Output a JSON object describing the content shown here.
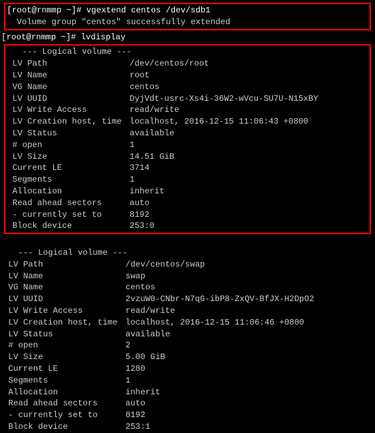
{
  "prompt1": {
    "full": "[root@rnmmp ~]# ",
    "command": "vgextend centos /dev/sdb1"
  },
  "output1": "  Volume group \"centos\" successfully extended",
  "prompt2": {
    "full": "[root@rnmmp ~]# ",
    "command": "lvdisplay"
  },
  "header": "  --- Logical volume ---",
  "vol1": {
    "lv_path_label": "  LV Path",
    "lv_path": "/dev/centos/root",
    "lv_name_label": "  LV Name",
    "lv_name": "root",
    "vg_name_label": "  VG Name",
    "vg_name": "centos",
    "lv_uuid_label": "  LV UUID",
    "lv_uuid": "DyjVdt-usrc-Xs4i-36W2-wVcu-SU7U-N15xBY",
    "lv_write_label": "  LV Write Access",
    "lv_write": "read/write",
    "lv_creation_label": "  LV Creation host, time",
    "lv_creation": "localhost, 2016-12-15 11:06:43 +0800",
    "lv_status_label": "  LV Status",
    "lv_status": "available",
    "open_label": "  # open",
    "open": "1",
    "lv_size_label": "  LV Size",
    "lv_size": "14.51 GiB",
    "current_le_label": "  Current LE",
    "current_le": "3714",
    "segments_label": "  Segments",
    "segments": "1",
    "allocation_label": "  Allocation",
    "allocation": "inherit",
    "read_ahead_label": "  Read ahead sectors",
    "read_ahead": "auto",
    "currently_set_label": "  - currently set to",
    "currently_set": "8192",
    "block_device_label": "  Block device",
    "block_device": "253:0"
  },
  "vol2": {
    "lv_path_label": "  LV Path",
    "lv_path": "/dev/centos/swap",
    "lv_name_label": "  LV Name",
    "lv_name": "swap",
    "vg_name_label": "  VG Name",
    "vg_name": "centos",
    "lv_uuid_label": "  LV UUID",
    "lv_uuid": "2vzuW0-CNbr-N7qG-ibP8-ZxQV-BfJX-H2DpO2",
    "lv_write_label": "  LV Write Access",
    "lv_write": "read/write",
    "lv_creation_label": "  LV Creation host, time",
    "lv_creation": "localhost, 2016-12-15 11:06:46 +0800",
    "lv_status_label": "  LV Status",
    "lv_status": "available",
    "open_label": "  # open",
    "open": "2",
    "lv_size_label": "  LV Size",
    "lv_size": "5.00 GiB",
    "current_le_label": "  Current LE",
    "current_le": "1280",
    "segments_label": "  Segments",
    "segments": "1",
    "allocation_label": "  Allocation",
    "allocation": "inherit",
    "read_ahead_label": "  Read ahead sectors",
    "read_ahead": "auto",
    "currently_set_label": "  - currently set to",
    "currently_set": "8192",
    "block_device_label": "  Block device",
    "block_device": "253:1"
  }
}
